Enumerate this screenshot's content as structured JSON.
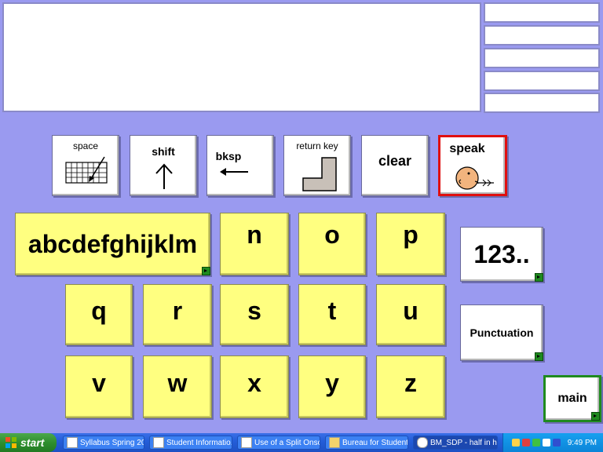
{
  "command_keys": {
    "space": "space",
    "shift": "shift",
    "bksp": "bksp",
    "return_key": "return key",
    "clear": "clear",
    "speak": "speak"
  },
  "letter_keys": [
    "abcdefghijklm",
    "n",
    "o",
    "p",
    "q",
    "r",
    "s",
    "t",
    "u",
    "v",
    "w",
    "x",
    "y",
    "z"
  ],
  "side_keys": {
    "numbers": "123..",
    "punctuation": "Punctuation",
    "main": "main"
  },
  "taskbar": {
    "start_label": "start",
    "buttons": [
      "Syllabus Spring 20...",
      "Student Informatio...",
      "Use of a Split Onsc...",
      "Bureau for Student...",
      "BM_SDP - half in h..."
    ],
    "clock": "9:49 PM"
  },
  "colors": {
    "background": "#9a9af0",
    "key_yellow": "#ffff80",
    "speak_border": "#e01010",
    "taskbar_blue": "#245ed9"
  }
}
